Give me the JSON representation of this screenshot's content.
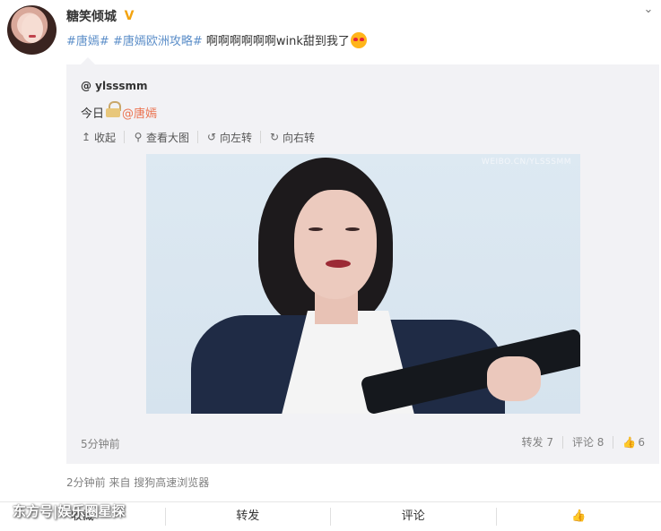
{
  "author": {
    "name": "糖笑倾城"
  },
  "post": {
    "topic1": "#唐嫣#",
    "topic2": "#唐嫣欧洲攻略#",
    "text": "啊啊啊啊啊啊wink甜到我了"
  },
  "repost": {
    "user": "@ ylsssmm",
    "text_prefix": "今日",
    "mention": "@唐嫣",
    "toolbar": {
      "collapse": "收起",
      "view_large": "查看大图",
      "rotate_left": "向左转",
      "rotate_right": "向右转"
    },
    "media_watermark": "WEIBO.CN/YLSSSMM",
    "time": "5分钟前",
    "actions": {
      "forward": "转发 7",
      "comment": "评论 8",
      "like": "6"
    }
  },
  "meta": "2分钟前 来自 搜狗高速浏览器",
  "bottom": {
    "collect": "收藏",
    "forward": "转发",
    "comment": "评论"
  },
  "watermark": "东方号|娱乐圈星探",
  "colors": {
    "topic": "#5d8fc9",
    "mention": "#eb7350",
    "verified": "#f3a30f"
  }
}
